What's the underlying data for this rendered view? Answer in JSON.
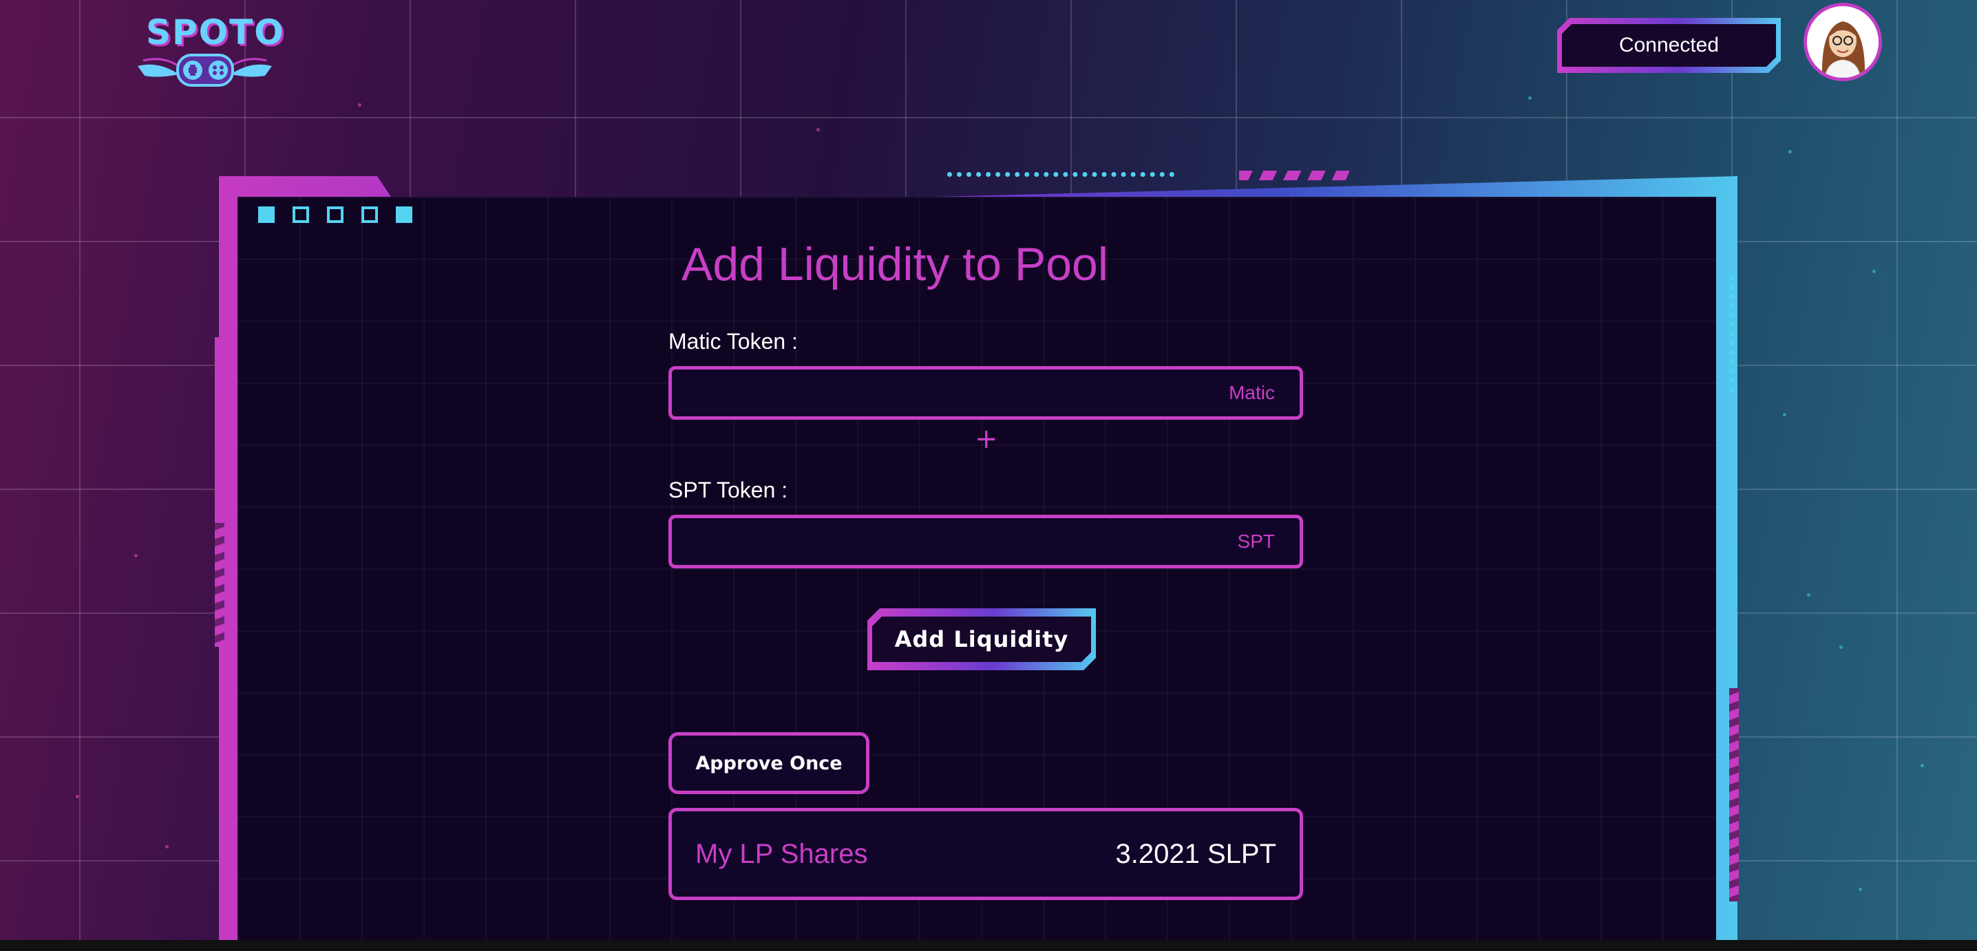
{
  "header": {
    "logo_text": "SPOTO",
    "status_label": "Connected",
    "avatar_alt": "avatar"
  },
  "main": {
    "title": "Add Liquidity to Pool",
    "matic": {
      "label": "Matic Token :",
      "value": "",
      "unit": "Matic"
    },
    "plus_symbol": "+",
    "spt": {
      "label": "SPT Token :",
      "value": "",
      "unit": "SPT"
    },
    "add_button": "Add Liquidity",
    "approve_button": "Approve Once",
    "shares": {
      "label": "My LP Shares",
      "value": "3.2021 SLPT"
    }
  },
  "colors": {
    "accent_pink": "#c83fc6",
    "accent_cyan": "#55d4f2",
    "panel_bg": "#0f0523"
  }
}
